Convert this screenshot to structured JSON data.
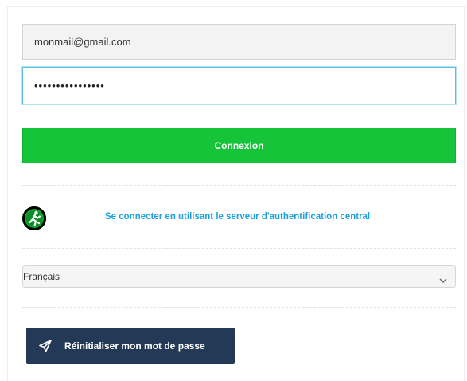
{
  "login": {
    "email_value": "monmail@gmail.com",
    "password_value": "••••••••••••••••",
    "connect_label": "Connexion"
  },
  "cas": {
    "icon": "running-man-icon",
    "link_label": "Se connecter en utilisant le serveur d'authentification central"
  },
  "language": {
    "selected": "Français"
  },
  "reset": {
    "icon": "paper-plane-icon",
    "label": "Réinitialiser mon mot de passe"
  },
  "colors": {
    "connect_button": "#16c43a",
    "link": "#1da1dc",
    "reset_button": "#233955",
    "focus_border": "#5bc0de"
  }
}
